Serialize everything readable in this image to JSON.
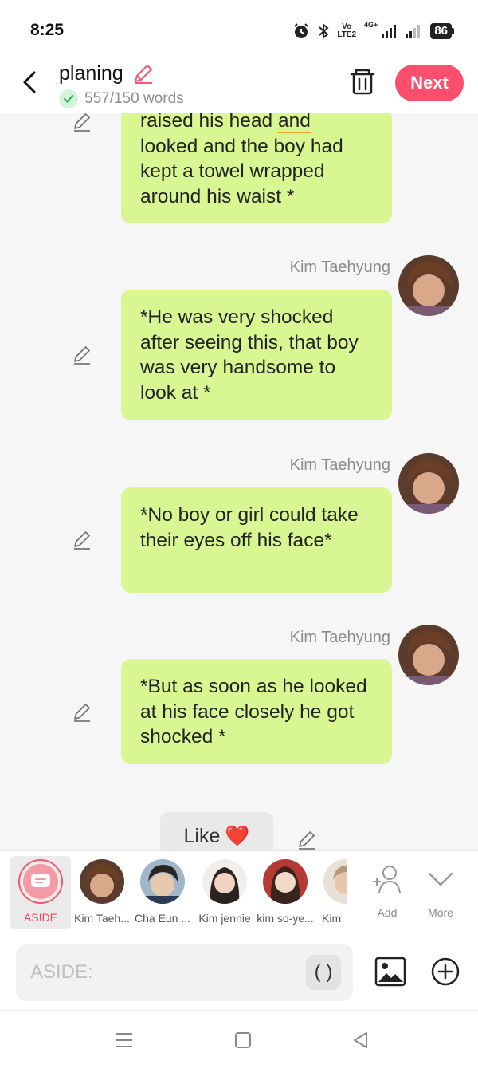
{
  "status_bar": {
    "time": "8:25",
    "battery": "86",
    "volte": "Vo",
    "volte_sub": "LTE2",
    "network": "4G+"
  },
  "header": {
    "title": "planing",
    "word_count": "557/150 words",
    "next_label": "Next"
  },
  "chat": {
    "messages": [
      {
        "text_before": "raised his head ",
        "underlined": "and",
        "text_after": " looked and the boy had kept a towel wrapped around his waist *"
      },
      {
        "speaker": "Kim Taehyung",
        "text": "*He was very shocked after seeing this, that boy was very handsome to look at *"
      },
      {
        "speaker": "Kim Taehyung",
        "text": "*No boy or girl could take their eyes off his face*"
      },
      {
        "speaker": "Kim Taehyung",
        "text": "*But as soon as he looked at his face closely he got shocked *"
      }
    ],
    "like_label": "Like",
    "like_emoji": "❤️"
  },
  "characters": {
    "aside_label": "ASIDE",
    "items": [
      {
        "label": "Kim Taeh..."
      },
      {
        "label": "Cha Eun ..."
      },
      {
        "label": "Kim jennie"
      },
      {
        "label": "kim so-ye..."
      },
      {
        "label": "Kim"
      }
    ],
    "add_label": "Add",
    "more_label": "More"
  },
  "input": {
    "placeholder": "ASIDE:",
    "paren_label": "( )"
  },
  "colors": {
    "accent": "#fb4f6d",
    "bubble": "#d8f792",
    "aside": "#f2455e"
  }
}
